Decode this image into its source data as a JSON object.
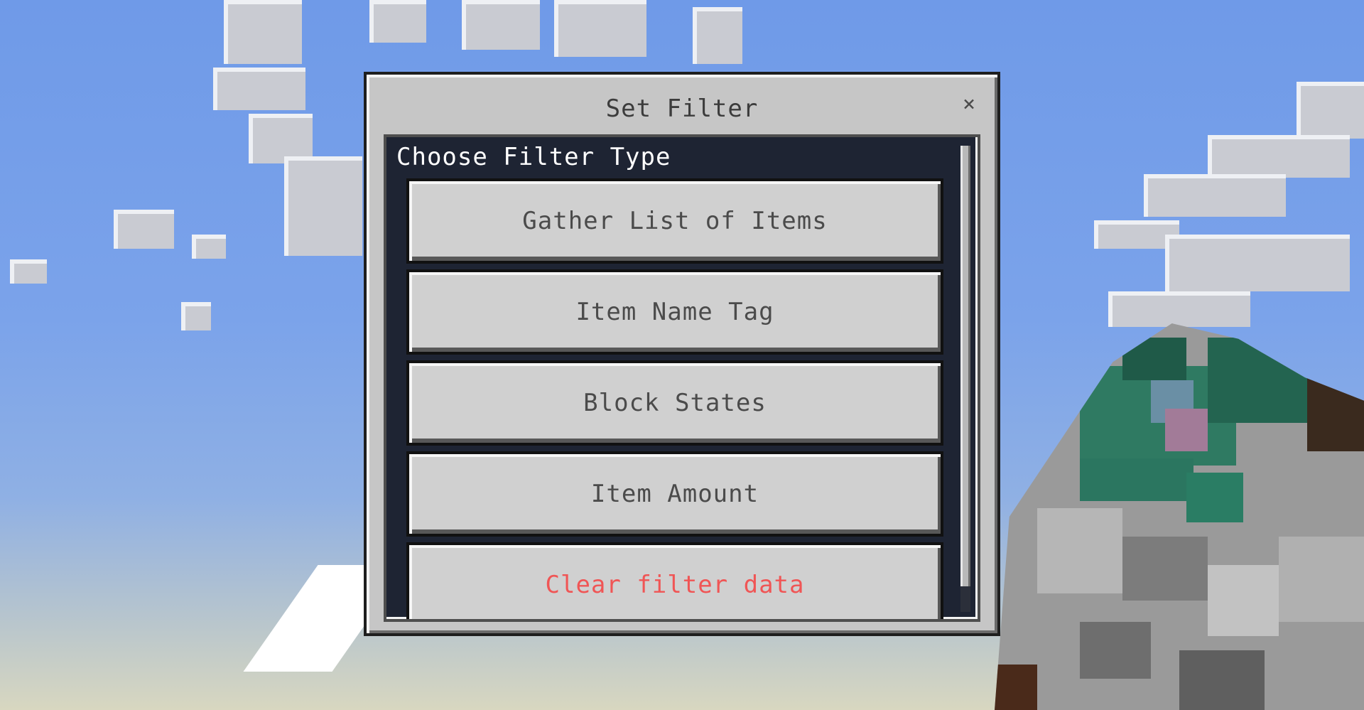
{
  "dialog": {
    "title": "Set Filter",
    "close_symbol": "×",
    "close_icon": "close-icon"
  },
  "panel": {
    "heading": "Choose Filter Type",
    "options": [
      {
        "label": "Gather List of Items"
      },
      {
        "label": "Item Name Tag"
      },
      {
        "label": "Block States"
      },
      {
        "label": "Item Amount"
      },
      {
        "label": "Clear filter data"
      }
    ]
  },
  "colors": {
    "panel_bg": "#1e2433",
    "button_face": "#d0d0d0",
    "button_text": "#4b4b4b",
    "danger_text": "#f05555",
    "sky": "#7ba3ea"
  }
}
